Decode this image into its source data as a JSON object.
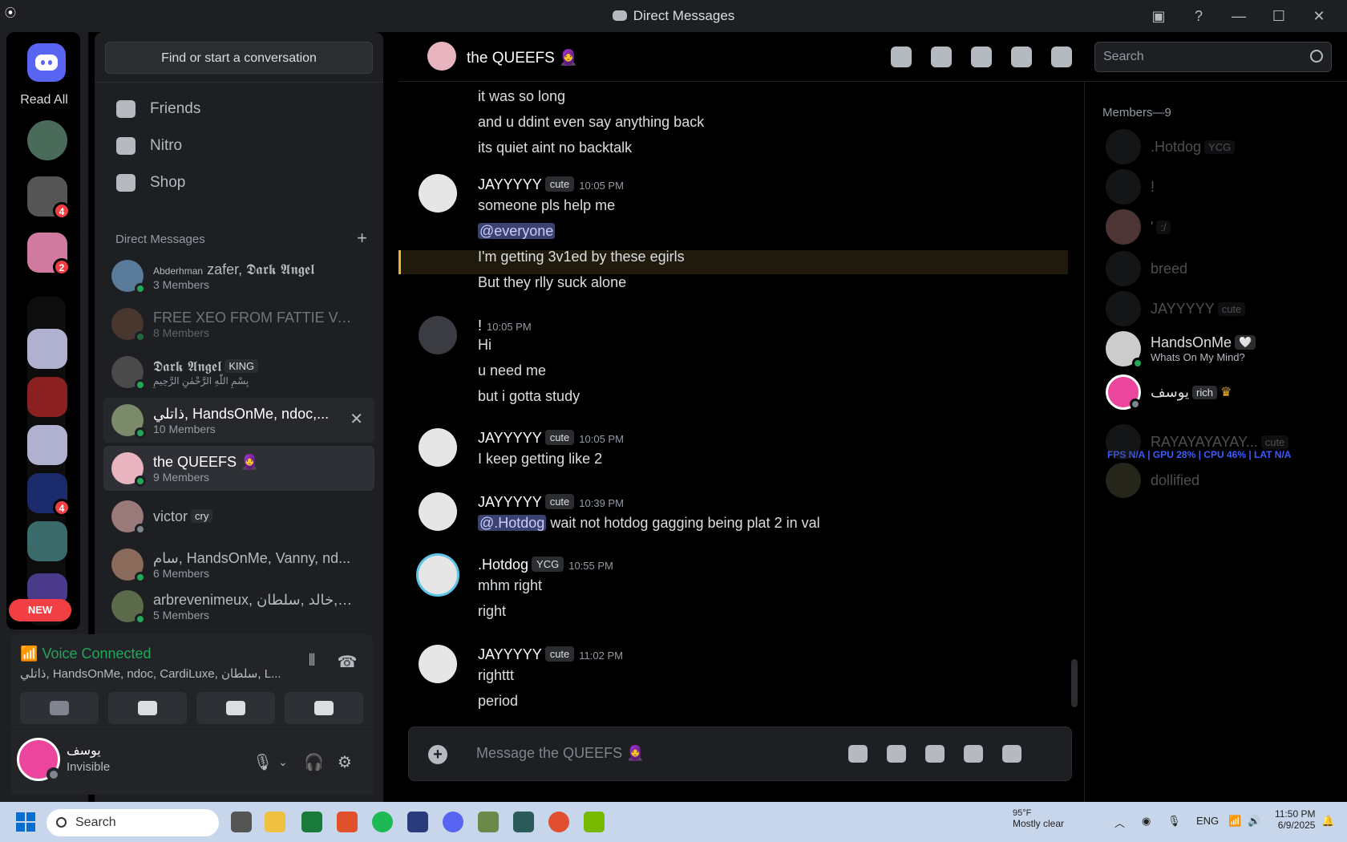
{
  "window": {
    "title": "Direct Messages"
  },
  "rail": {
    "read_all": "Read All",
    "badges": [
      "4",
      "2",
      "4"
    ],
    "new_label": "NEW"
  },
  "sidebar": {
    "find_placeholder": "Find or start a conversation",
    "nav": [
      {
        "label": "Friends",
        "icon": "friends-icon"
      },
      {
        "label": "Nitro",
        "icon": "nitro-icon"
      },
      {
        "label": "Shop",
        "icon": "shop-icon"
      }
    ],
    "dm_header": "Direct Messages",
    "dms": [
      {
        "name_prefix": "Abderhman",
        "name": "zafer, 𝕯𝖆𝖗𝖐 𝕬𝖓𝖌𝖊𝖑",
        "sub": "3 Members",
        "color": "#5a7a9a"
      },
      {
        "name": "FREE XEO FROM FATTIE VA...",
        "sub": "8 Members",
        "color": "#6b4a3a"
      },
      {
        "name": "𝕯𝖆𝖗𝖐 𝕬𝖓𝖌𝖊𝖑",
        "tag": "KING",
        "sub": "بِسْمِ اللّٰهِ الرَّحْمٰنِ الرَّحِيمِ",
        "color": "#4a4a4a"
      },
      {
        "name": "ذاتلي, HandsOnMe, ndoc,...",
        "sub": "10 Members",
        "color": "#7a8a6a"
      },
      {
        "name": "the QUEEFS 🧕",
        "sub": "9 Members",
        "color": "#e8b4c0"
      },
      {
        "name": "victor",
        "tag": "cry",
        "sub": "",
        "color": "#9a7a7a"
      },
      {
        "name": "سام, HandsOnMe, Vanny, nd...",
        "sub": "6 Members",
        "color": "#8a6a5a"
      },
      {
        "name": "arbrevenimeux, خالد ,سلطان, r...",
        "sub": "5 Members",
        "color": "#5a6a4a"
      }
    ]
  },
  "voice": {
    "title": "Voice Connected",
    "members": "ذاتلي, HandsOnMe, ndoc, CardiLuxe, سلطان, L..."
  },
  "user": {
    "name": "يوسف",
    "status": "Invisible"
  },
  "chat": {
    "title": "the QUEEFS 🧕",
    "search_placeholder": "Search",
    "composer_placeholder": "Message the QUEEFS 🧕",
    "members_header": "Members—9"
  },
  "messages": {
    "top_lines": [
      "it was so long",
      "and u ddint even say anything back",
      "its quiet aint no backtalk"
    ],
    "m1": {
      "author": "JAYYYYY",
      "tag": "cute",
      "time": "10:05 PM",
      "lines": [
        "someone pls help me",
        "@everyone",
        "I'm getting 3v1ed by these egirls",
        "But they rlly suck alone"
      ]
    },
    "m2": {
      "author": "!",
      "time": "10:05 PM",
      "lines": [
        "Hi",
        "u need me",
        "but i gotta study"
      ]
    },
    "m3": {
      "author": "JAYYYYY",
      "tag": "cute",
      "time": "10:05 PM",
      "lines": [
        "I keep getting like 2"
      ]
    },
    "m4": {
      "author": "JAYYYYY",
      "tag": "cute",
      "time": "10:39 PM",
      "mention": "@.Hotdog",
      "rest": "wait not hotdog gagging being plat 2 in val"
    },
    "m5": {
      "author": ".Hotdog",
      "tag": "YCG",
      "time": "10:55 PM",
      "lines": [
        "mhm right",
        "right"
      ]
    },
    "m6": {
      "author": "JAYYYYY",
      "tag": "cute",
      "time": "11:02 PM",
      "lines": [
        "righttt",
        "period"
      ]
    }
  },
  "members": [
    {
      "name": ".Hotdog",
      "tag": "YCG",
      "online": false
    },
    {
      "name": "!",
      "online": false
    },
    {
      "name": "'",
      "tag": ":/",
      "online": false
    },
    {
      "name": "breed",
      "online": false
    },
    {
      "name": "JAYYYYY",
      "tag": "cute",
      "online": false
    },
    {
      "name": "HandsOnMe",
      "tag": "🤍",
      "activity": "Whats On My Mind?",
      "online": true
    },
    {
      "name": "يوسف",
      "tag": "rich",
      "online": true
    },
    {
      "name": "RAYAYAYAYAY...",
      "tag": "cute",
      "online": false
    },
    {
      "name": "dollified",
      "online": false
    }
  ],
  "overlay": {
    "text": "FPS N/A  |  GPU 28%  |  CPU 46%  |  LAT N/A"
  },
  "taskbar": {
    "search": "Search",
    "weather_temp": "95°F",
    "weather_desc": "Mostly clear",
    "lang": "ENG",
    "time": "11:50 PM",
    "date": "6/9/2025"
  }
}
